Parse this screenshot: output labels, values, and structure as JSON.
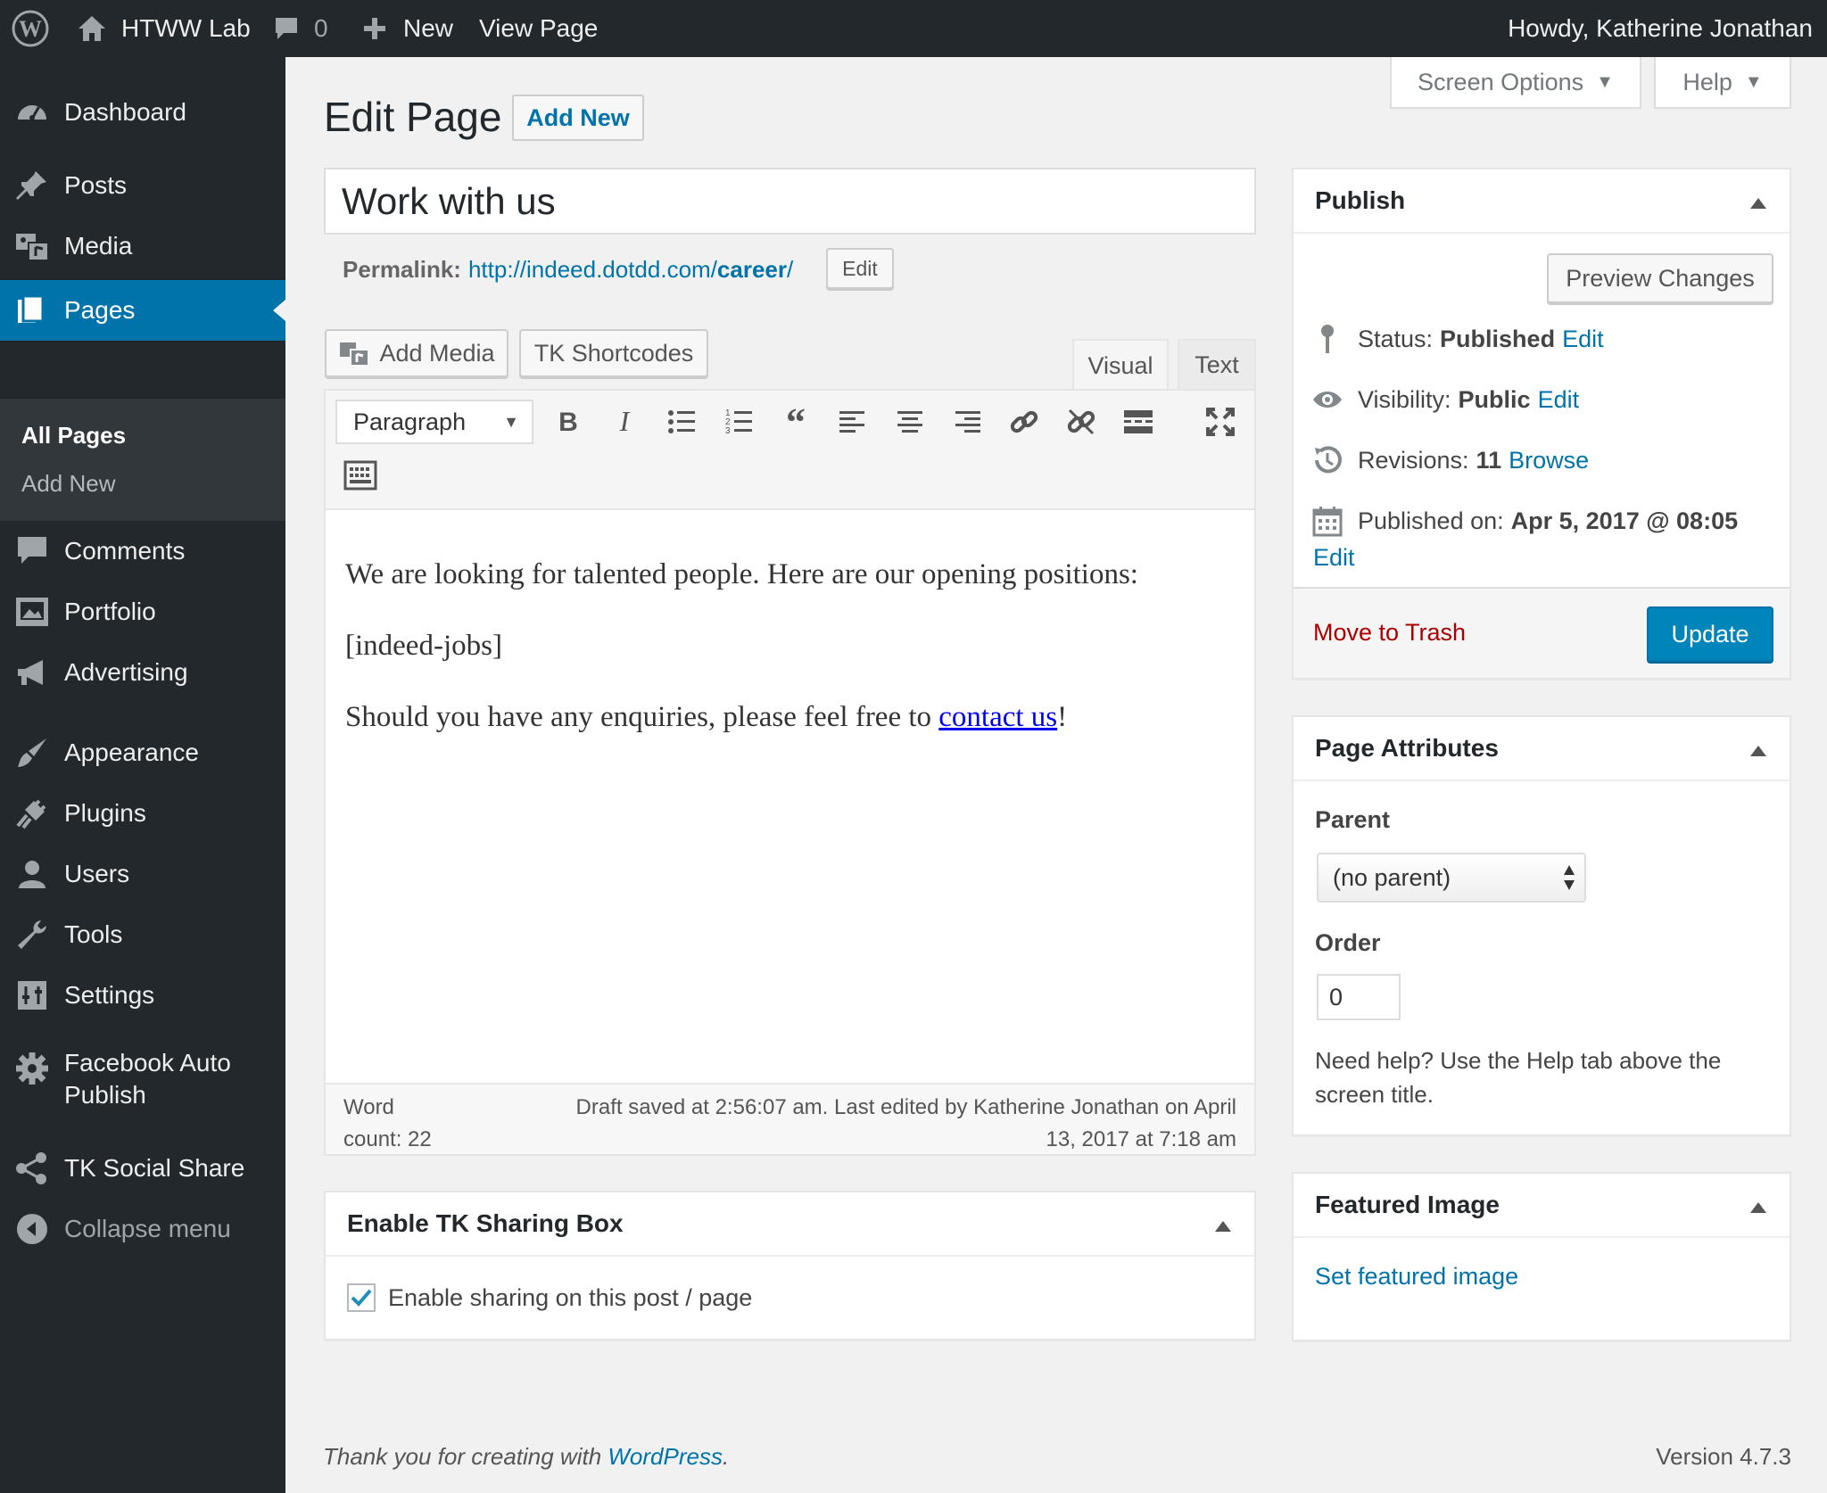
{
  "adminbar": {
    "site_name": "HTWW Lab",
    "comments_count": "0",
    "new_label": "New",
    "view_page_label": "View Page",
    "howdy": "Howdy, Katherine Jonathan"
  },
  "sidebar": {
    "dashboard": "Dashboard",
    "posts": "Posts",
    "media": "Media",
    "pages": "Pages",
    "all_pages": "All Pages",
    "add_new": "Add New",
    "comments": "Comments",
    "portfolio": "Portfolio",
    "advertising": "Advertising",
    "appearance": "Appearance",
    "plugins": "Plugins",
    "users": "Users",
    "tools": "Tools",
    "settings": "Settings",
    "facebook_1": "Facebook Auto",
    "facebook_2": "Publish",
    "tk_social": "TK Social Share",
    "collapse": "Collapse menu"
  },
  "screen_options": "Screen Options",
  "help": "Help",
  "heading": {
    "title": "Edit Page",
    "add_new": "Add New"
  },
  "post": {
    "title": "Work with us",
    "permalink_label": "Permalink:",
    "permalink_base": "http://indeed.dotdd.com/",
    "permalink_slug": "career",
    "permalink_end": "/",
    "permalink_edit": "Edit"
  },
  "editor": {
    "add_media": "Add Media",
    "tk_shortcodes": "TK Shortcodes",
    "tab_visual": "Visual",
    "tab_text": "Text",
    "format_select": "Paragraph",
    "para1": "We are looking for talented people. Here are our opening positions:",
    "para2": "[indeed-jobs]",
    "para3_pre": "Should you have any enquiries, please feel free to ",
    "para3_link": "contact us",
    "para3_post": "!",
    "wordcount_1": "Word",
    "wordcount_2": "count: 22",
    "draft_1": "Draft saved at 2:56:07 am. Last edited by Katherine Jonathan on April",
    "draft_2": "13, 2017 at 7:18 am"
  },
  "sharing_box": {
    "title": "Enable TK Sharing Box",
    "checkbox_label": "Enable sharing on this post / page",
    "checked": true
  },
  "publish": {
    "title": "Publish",
    "preview": "Preview Changes",
    "status_label": "Status:",
    "status_value": "Published",
    "visibility_label": "Visibility:",
    "visibility_value": "Public",
    "revisions_label": "Revisions:",
    "revisions_value": "11",
    "browse": "Browse",
    "published_label": "Published on:",
    "published_value": "Apr 5, 2017 @ 08:05",
    "edit": "Edit",
    "trash": "Move to Trash",
    "update": "Update"
  },
  "attributes": {
    "title": "Page Attributes",
    "parent_label": "Parent",
    "parent_value": "(no parent)",
    "order_label": "Order",
    "order_value": "0",
    "help_1": "Need help? Use the Help tab above the",
    "help_2": "screen title."
  },
  "featured": {
    "title": "Featured Image",
    "set": "Set featured image"
  },
  "footer": {
    "thanks": "Thank you for creating with ",
    "wp": "WordPress",
    "period": ".",
    "version": "Version 4.7.3"
  },
  "colors": {
    "sidebar": "#23282d",
    "accent": "#0073aa",
    "trash": "#a00",
    "update": "#0085ba"
  }
}
